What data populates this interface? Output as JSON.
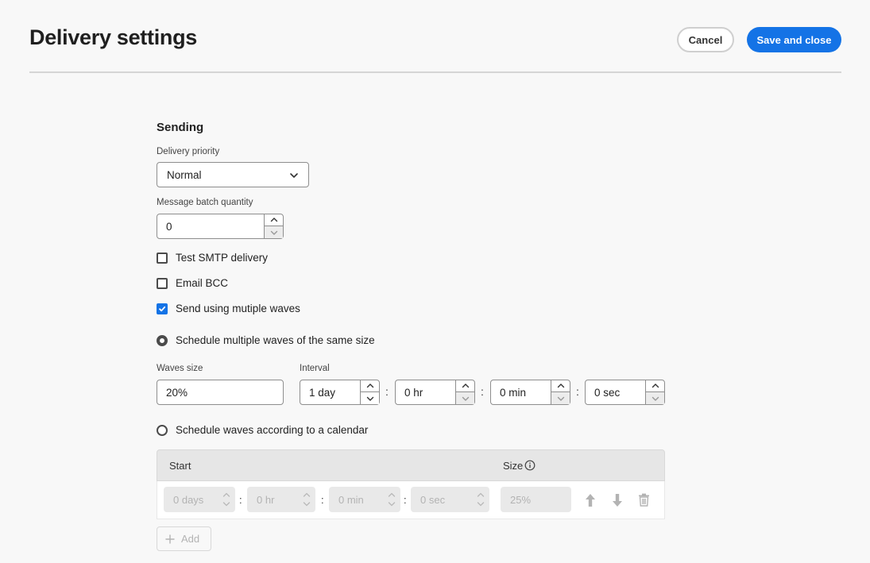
{
  "header": {
    "title": "Delivery settings",
    "cancel_label": "Cancel",
    "save_label": "Save and close"
  },
  "sending": {
    "section_title": "Sending",
    "priority_label": "Delivery priority",
    "priority_value": "Normal",
    "batch_label": "Message batch quantity",
    "batch_value": "0",
    "test_smtp_label": "Test SMTP delivery",
    "test_smtp_checked": false,
    "email_bcc_label": "Email BCC",
    "email_bcc_checked": false,
    "waves_label": "Send using mutiple waves",
    "waves_checked": true,
    "radio_same_size_label": "Schedule multiple waves of the same size",
    "radio_same_size_selected": true,
    "waves_size_label": "Waves size",
    "waves_size_value": "20%",
    "interval_label": "Interval",
    "interval_days": "1 day",
    "interval_hours": "0 hr",
    "interval_minutes": "0 min",
    "interval_seconds": "0 sec",
    "radio_calendar_label": "Schedule waves according to a calendar",
    "radio_calendar_selected": false
  },
  "calendar_table": {
    "col_start": "Start",
    "col_size": "Size",
    "rows": [
      {
        "days": "0 days",
        "hours": "0 hr",
        "minutes": "0 min",
        "seconds": "0 sec",
        "size": "25%"
      }
    ],
    "add_label": "Add"
  },
  "colors": {
    "accent": "#1473e6",
    "background": "#f8f8f8"
  }
}
